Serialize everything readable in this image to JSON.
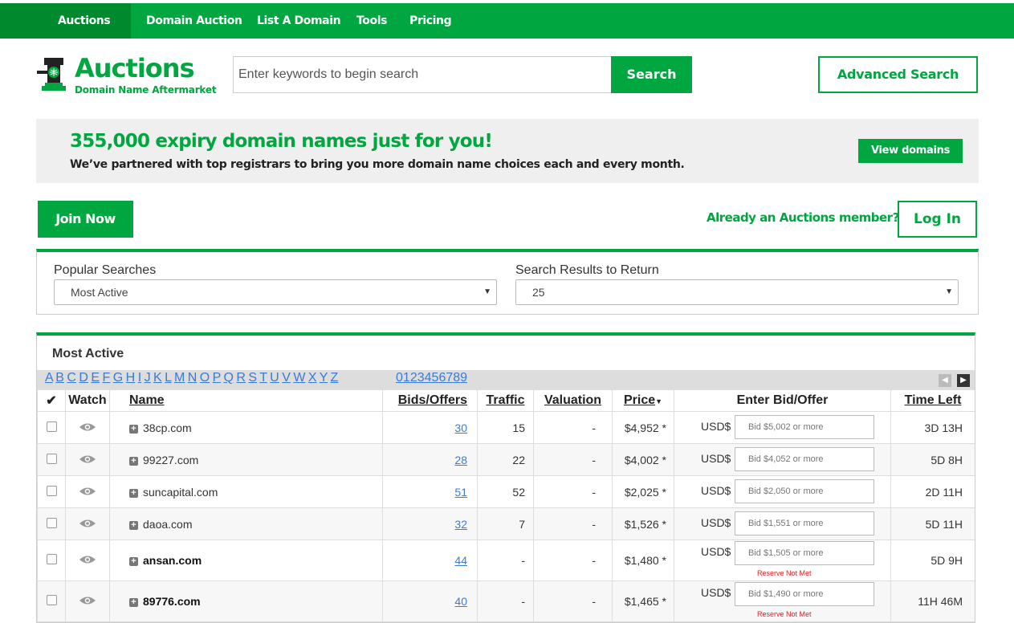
{
  "nav": {
    "items": [
      "Auctions",
      "Domain Auction",
      "List A Domain",
      "Tools",
      "Pricing"
    ]
  },
  "logo": {
    "title": "Auctions",
    "subtitle": "Domain Name Aftermarket"
  },
  "search": {
    "placeholder": "Enter keywords to begin search",
    "button": "Search",
    "advanced": "Advanced Search"
  },
  "promo": {
    "headline": "355,000 expiry domain names just for you!",
    "description": "We’ve partnered with top registrars to bring you more domain name choices each and every month.",
    "button": "View domains"
  },
  "member": {
    "join": "Join Now",
    "question": "Already an Auctions member?",
    "login": "Log In"
  },
  "filters": {
    "popular_label": "Popular Searches",
    "popular_value": "Most Active",
    "results_label": "Search Results to Return",
    "results_value": "25"
  },
  "results": {
    "title": "Most Active",
    "letters": [
      "A",
      "B",
      "C",
      "D",
      "E",
      "F",
      "G",
      "H",
      "I",
      "J",
      "K",
      "L",
      "M",
      "N",
      "O",
      "P",
      "Q",
      "R",
      "S",
      "T",
      "U",
      "V",
      "W",
      "X",
      "Y",
      "Z"
    ],
    "digits": [
      "0",
      "1",
      "2",
      "3",
      "4",
      "5",
      "6",
      "7",
      "8",
      "9"
    ],
    "columns": {
      "check": "✔",
      "watch": "Watch",
      "name": "Name",
      "bids": "Bids/Offers",
      "traffic": "Traffic",
      "valuation": "Valuation",
      "price": "Price",
      "bid": "Enter Bid/Offer",
      "time": "Time Left"
    },
    "currency": "USD$",
    "rows": [
      {
        "name": "38cp.com",
        "bold": false,
        "bids": "30",
        "traffic": "15",
        "valuation": "-",
        "price": "$4,952 *",
        "bid_placeholder": "Bid $5,002 or more",
        "reserve": "",
        "time": "3D 13H"
      },
      {
        "name": "99227.com",
        "bold": false,
        "bids": "28",
        "traffic": "22",
        "valuation": "-",
        "price": "$4,002 *",
        "bid_placeholder": "Bid $4,052 or more",
        "reserve": "",
        "time": "5D 8H"
      },
      {
        "name": "suncapital.com",
        "bold": false,
        "bids": "51",
        "traffic": "52",
        "valuation": "-",
        "price": "$2,025 *",
        "bid_placeholder": "Bid $2,050 or more",
        "reserve": "",
        "time": "2D 11H"
      },
      {
        "name": "daoa.com",
        "bold": false,
        "bids": "32",
        "traffic": "7",
        "valuation": "-",
        "price": "$1,526 *",
        "bid_placeholder": "Bid $1,551 or more",
        "reserve": "",
        "time": "5D 11H"
      },
      {
        "name": "ansan.com",
        "bold": true,
        "bids": "44",
        "traffic": "-",
        "valuation": "-",
        "price": "$1,480 *",
        "bid_placeholder": "Bid $1,505 or more",
        "reserve": "Reserve Not Met",
        "time": "5D 9H"
      },
      {
        "name": "89776.com",
        "bold": true,
        "bids": "40",
        "traffic": "-",
        "valuation": "-",
        "price": "$1,465 *",
        "bid_placeholder": "Bid $1,490 or more",
        "reserve": "Reserve Not Met",
        "time": "11H 46M"
      }
    ]
  },
  "colors": {
    "brand": "#00a63f",
    "brand_dark": "#008a2e",
    "link": "#3a7bd5",
    "reserve": "#e02020"
  }
}
